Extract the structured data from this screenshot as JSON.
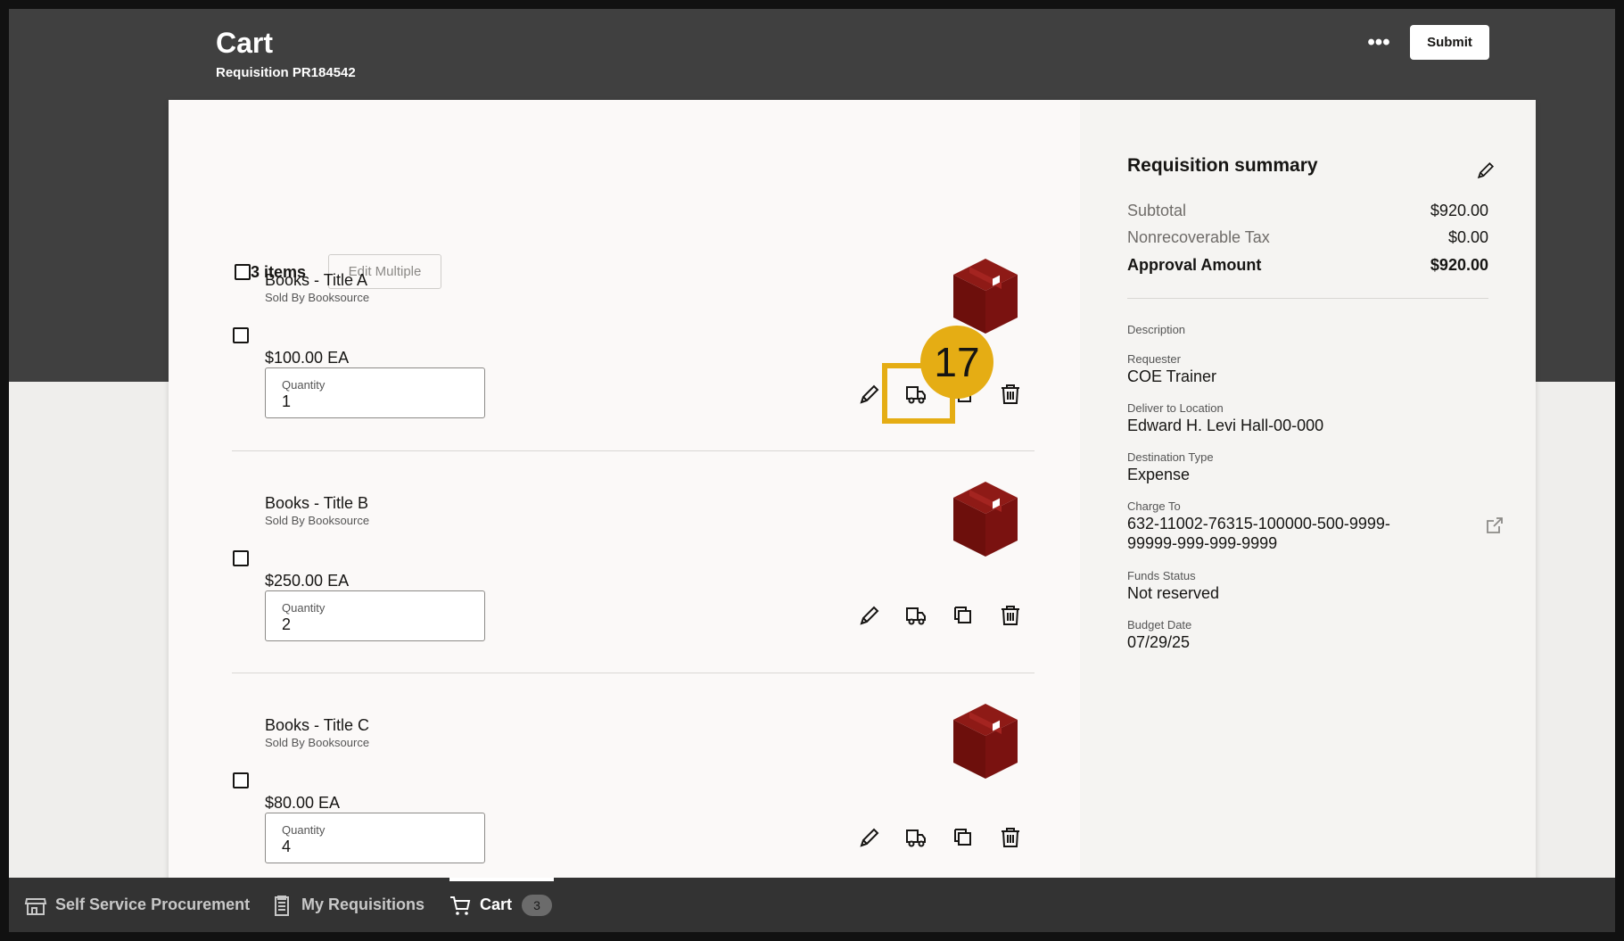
{
  "header": {
    "title": "Cart",
    "subtitle": "Requisition PR184542",
    "more_label": "•••",
    "submit_label": "Submit"
  },
  "list": {
    "items_count_label": "3 items",
    "edit_multiple_label": "Edit Multiple",
    "quantity_label": "Quantity"
  },
  "items": [
    {
      "title": "Books - Title A",
      "seller": "Sold By Booksource",
      "price": "$100.00 EA",
      "quantity": "1"
    },
    {
      "title": "Books - Title B",
      "seller": "Sold By Booksource",
      "price": "$250.00 EA",
      "quantity": "2"
    },
    {
      "title": "Books - Title C",
      "seller": "Sold By Booksource",
      "price": "$80.00 EA",
      "quantity": "4"
    }
  ],
  "summary": {
    "title": "Requisition summary",
    "subtotal_label": "Subtotal",
    "subtotal_value": "$920.00",
    "tax_label": "Nonrecoverable Tax",
    "tax_value": "$0.00",
    "approval_label": "Approval Amount",
    "approval_value": "$920.00",
    "description_label": "Description",
    "requester_label": "Requester",
    "requester_value": "COE Trainer",
    "deliver_label": "Deliver to Location",
    "deliver_value": "Edward H. Levi Hall-00-000",
    "destination_label": "Destination Type",
    "destination_value": "Expense",
    "charge_label": "Charge To",
    "charge_line1": "632-11002-76315-100000-500-9999-",
    "charge_line2": "99999-999-999-9999",
    "funds_label": "Funds Status",
    "funds_value": "Not reserved",
    "budget_label": "Budget Date",
    "budget_value": "07/29/25"
  },
  "bottom_nav": {
    "self_service": "Self Service Procurement",
    "my_requisitions": "My Requisitions",
    "cart": "Cart",
    "cart_count": "3"
  },
  "annotation": {
    "step_number": "17",
    "color": "#e5ad14"
  },
  "colors": {
    "header_bg": "#404040",
    "box_icon": "#7a1210",
    "bottom_bar": "#333333"
  },
  "icons": [
    "edit-icon",
    "truck-icon",
    "duplicate-icon",
    "delete-icon",
    "box-icon",
    "external-link-icon",
    "store-icon",
    "clipboard-icon",
    "cart-icon"
  ]
}
